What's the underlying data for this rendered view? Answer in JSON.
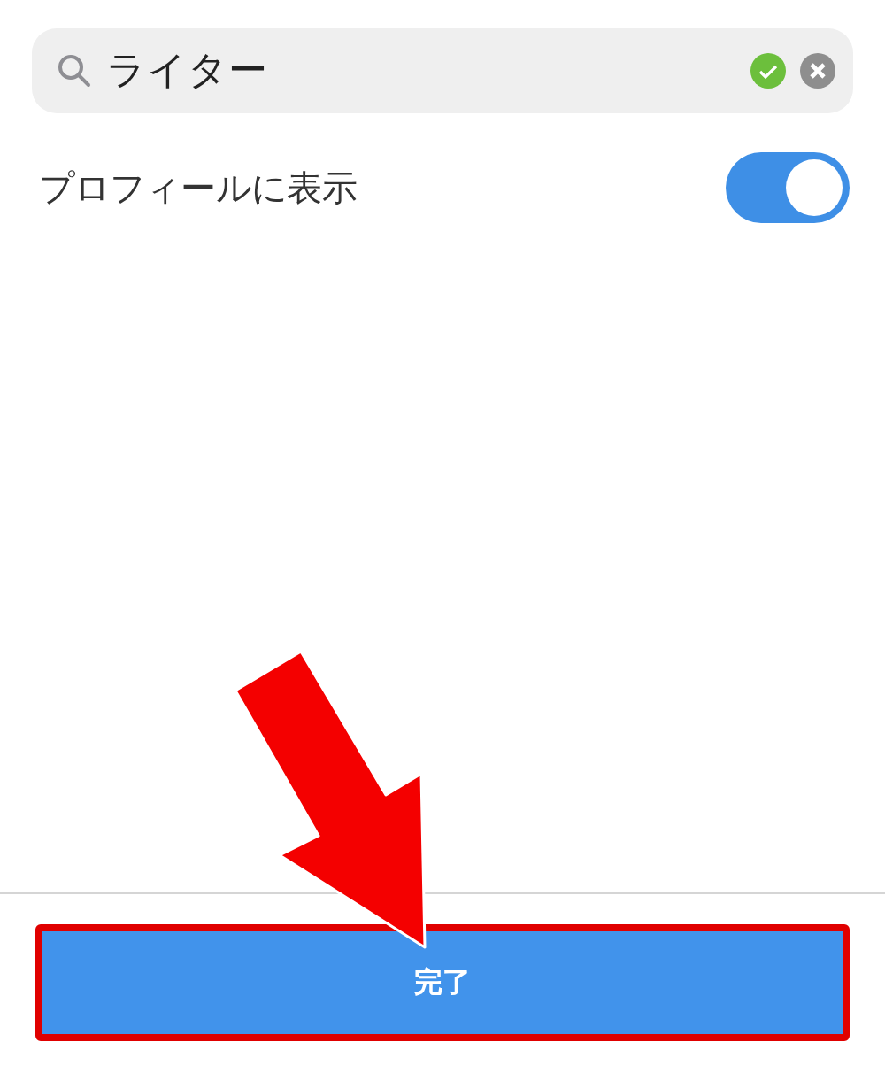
{
  "search": {
    "value": "ライター",
    "verified": true
  },
  "setting": {
    "label": "プロフィールに表示",
    "on": true
  },
  "done_button": {
    "label": "完了",
    "highlighted": true
  }
}
